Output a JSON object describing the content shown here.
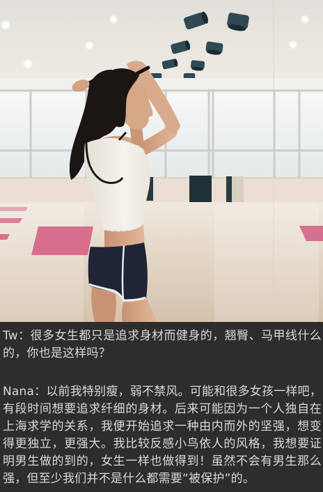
{
  "theme": {
    "background": "#2d2d2d",
    "text_color": "#d9d9d9"
  },
  "article": {
    "paragraphs": [
      "Tw：很多女生都只是追求身材而健身的，翘臀、马甲线什么的，你也是这样吗？",
      "Nana：以前我特别瘦，弱不禁风。可能和很多女孩一样吧，有段时间想要追求纤细的身材。后来可能因为一个人独自在上海求学的关系，我便开始追求一种由内而外的坚强，想变得更独立，更强大。我比较反感小鸟依人的风格，我想要证明男生做的到的，女生一样也做得到！虽然不会有男生那么强，但至少我们并不是什么都需要“被保护”的。"
    ]
  }
}
